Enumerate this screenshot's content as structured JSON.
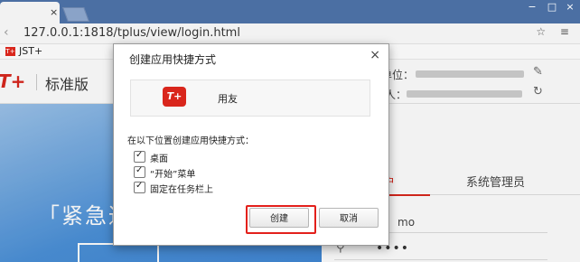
{
  "browser": {
    "url": "127.0.0.1:1818/tplus/view/login.html",
    "tab_close": "×",
    "window_controls": [
      "−",
      "□",
      "×"
    ],
    "addr_icons": "☆ ≡",
    "bookmark": {
      "icon": "T+",
      "label": "JST+"
    }
  },
  "header": {
    "logo": "T+",
    "edition": "标准版",
    "unit_label": "单位：",
    "user_label": "人："
  },
  "banner": {
    "text": "「紧急通"
  },
  "login": {
    "tab_user": "户",
    "tab_admin": "系统管理员",
    "username_value": "mo",
    "password_dots": "••••"
  },
  "dialog": {
    "title": "创建应用快捷方式",
    "close": "×",
    "app_icon": "T+",
    "app_name": "用友",
    "location_label": "在以下位置创建应用快捷方式：",
    "options": [
      {
        "label": "桌面",
        "checked": true
      },
      {
        "label": "“开始”菜单",
        "checked": true
      },
      {
        "label": "固定在任务栏上",
        "checked": true
      }
    ],
    "create_button": "创建",
    "cancel_button": "取消"
  },
  "colors": {
    "brand_red": "#d9261c",
    "tabstrip": "#4b6fa3",
    "banner_blue": "#4a90d8"
  }
}
